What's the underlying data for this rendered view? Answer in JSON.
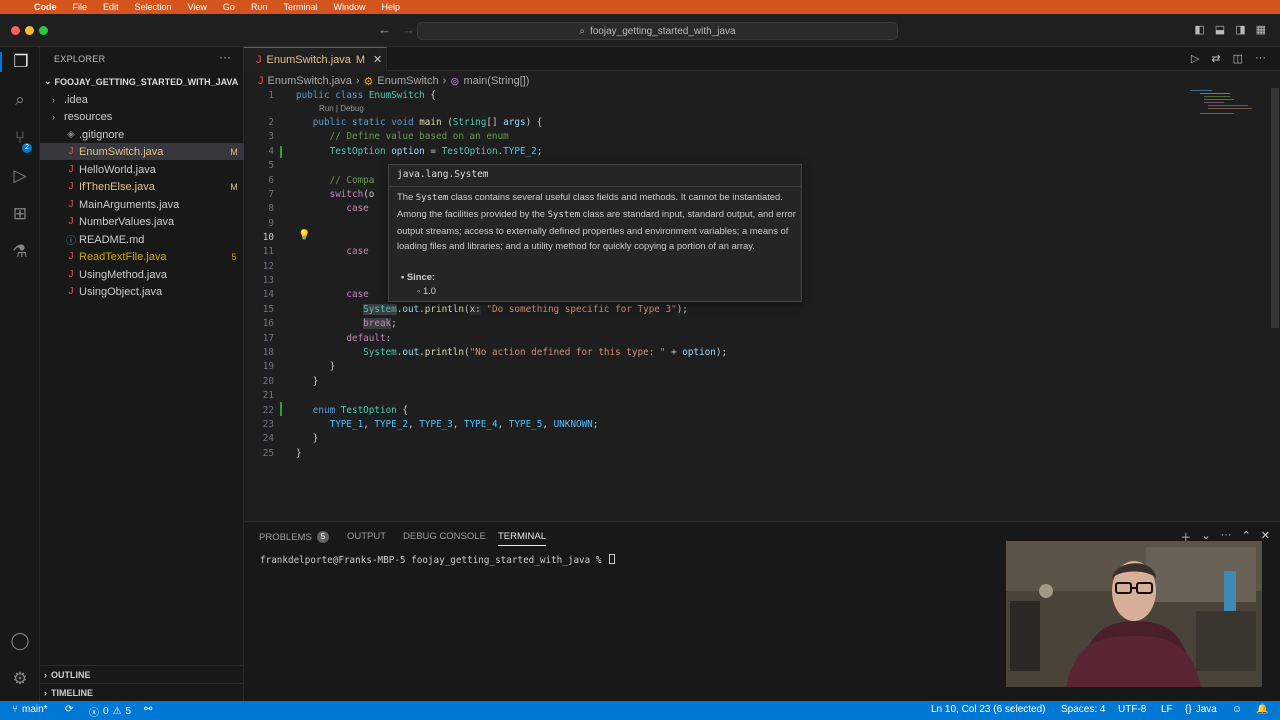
{
  "menubar": {
    "app": "Code",
    "items": [
      "File",
      "Edit",
      "Selection",
      "View",
      "Go",
      "Run",
      "Terminal",
      "Window",
      "Help"
    ]
  },
  "titlebar": {
    "search_text": "foojay_getting_started_with_java"
  },
  "explorer": {
    "title": "EXPLORER",
    "project": "FOOJAY_GETTING_STARTED_WITH_JAVA",
    "items": [
      {
        "name": ".idea",
        "type": "folder",
        "status": ""
      },
      {
        "name": "resources",
        "type": "folder",
        "status": ""
      },
      {
        "name": ".gitignore",
        "type": "file",
        "status": ""
      },
      {
        "name": "EnumSwitch.java",
        "type": "java",
        "status": "M"
      },
      {
        "name": "HelloWorld.java",
        "type": "java",
        "status": ""
      },
      {
        "name": "IfThenElse.java",
        "type": "java",
        "status": "M"
      },
      {
        "name": "MainArguments.java",
        "type": "java",
        "status": ""
      },
      {
        "name": "NumberValues.java",
        "type": "java",
        "status": ""
      },
      {
        "name": "README.md",
        "type": "md",
        "status": ""
      },
      {
        "name": "ReadTextFile.java",
        "type": "java",
        "status": "5"
      },
      {
        "name": "UsingMethod.java",
        "type": "java",
        "status": ""
      },
      {
        "name": "UsingObject.java",
        "type": "java",
        "status": ""
      }
    ],
    "outline": "OUTLINE",
    "timeline": "TIMELINE"
  },
  "activity_badge": "2",
  "tab": {
    "name": "EnumSwitch.java",
    "status": "M"
  },
  "breadcrumb": [
    "EnumSwitch.java",
    "EnumSwitch",
    "main(String[])"
  ],
  "codelens": "Run | Debug",
  "hover": {
    "signature": "java.lang.System",
    "doc_parts": [
      "The ",
      "System",
      " class contains several useful class fields and methods. It cannot be instantiated. Among the facilities provided by the ",
      "System",
      " class are standard input, standard output, and error output streams; access to externally defined properties and environment variables; a means of loading files and libraries; and a utility method for quickly copying a portion of an array."
    ],
    "since_label": "Since:",
    "since_value": "1.0"
  },
  "panel": {
    "tabs": [
      "PROBLEMS",
      "OUTPUT",
      "DEBUG CONSOLE",
      "TERMINAL"
    ],
    "problems_count": "5",
    "active": "TERMINAL",
    "prompt": "frankdelporte@Franks-MBP-5 foojay_getting_started_with_java % "
  },
  "statusbar": {
    "branch": "main*",
    "errors": "0",
    "warnings": "5",
    "position": "Ln 10, Col 23 (6 selected)",
    "spaces": "Spaces: 4",
    "encoding": "UTF-8",
    "eol": "LF",
    "language": "Java"
  },
  "icons": {
    "activity": [
      "files-icon",
      "search-icon",
      "source-control-icon",
      "run-debug-icon",
      "extensions-icon",
      "testing-icon",
      "account-icon",
      "settings-gear-icon"
    ]
  },
  "colors": {
    "accent": "#0078d4",
    "macbar": "#d4541e",
    "modified": "#e2c08d",
    "java_icon": "#f14c4c"
  }
}
